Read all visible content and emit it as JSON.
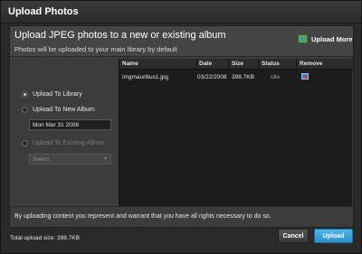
{
  "window": {
    "title": "Upload Photos"
  },
  "header": {
    "heading": "Upload JPEG photos to a new or existing album",
    "subheading": "Photos will be uploaded to your main library by default",
    "upload_more_label": "Upload More",
    "upload_more_icon": "photos-add-icon"
  },
  "options": {
    "upload_to_library": {
      "label": "Upload To Library",
      "selected": true
    },
    "upload_to_new_album": {
      "label": "Upload To New Album",
      "selected": false
    },
    "new_album_name": "Mon Mar 31 2008",
    "upload_to_existing_album": {
      "label": "Upload To Existing Album",
      "selected": false,
      "disabled": true
    },
    "existing_album_select": {
      "value": "Select..",
      "disabled": true
    }
  },
  "files": {
    "columns": [
      "Name",
      "Date",
      "Size",
      "Status",
      "Remove"
    ],
    "rows": [
      {
        "name": "imgmauritius1.jpg",
        "date": "03/22/2008",
        "size": "398.7KB",
        "status": "idle",
        "remove_icon": "remove-file-icon"
      }
    ]
  },
  "notice": "By uploading content you represent and warrant that you have all rights necessary to do so.",
  "footer": {
    "total": "Total upload size: 398.7KB",
    "cancel_label": "Cancel",
    "upload_label": "Upload"
  },
  "colors": {
    "accent": "#2a8fcc",
    "background": "#2a2a2a",
    "panel": "#3c3c3c",
    "list_background": "#1c1c1c"
  }
}
